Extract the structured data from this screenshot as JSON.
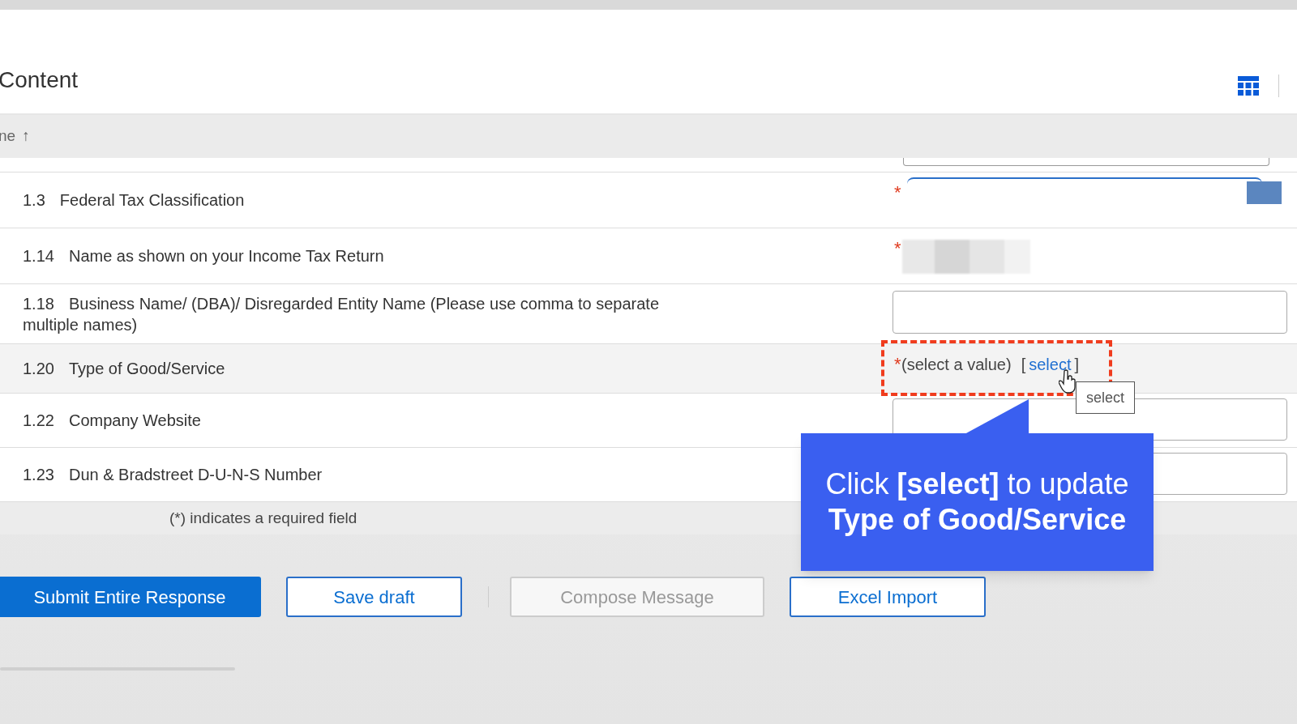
{
  "header": {
    "title": "Content"
  },
  "table": {
    "sort_column": "ne",
    "sort_arrow": "↑",
    "rows": [
      {
        "number": "1.3",
        "label": "Federal Tax Classification",
        "required_mark": "*",
        "highlighted": false,
        "kind": "dropdown"
      },
      {
        "number": "1.14",
        "label": "Name as shown on your Income Tax Return",
        "required_mark": "*",
        "highlighted": false,
        "kind": "redacted"
      },
      {
        "number": "1.18",
        "label": "Business Name/ (DBA)/ Disregarded Entity Name (Please use comma to separate multiple names)",
        "highlighted": false,
        "kind": "textarea"
      },
      {
        "number": "1.20",
        "label": "Type of Good/Service",
        "required_mark": "*",
        "highlighted": true,
        "kind": "select_value",
        "placeholder": "(select a value)",
        "bracket_left": "[",
        "link": "select",
        "bracket_right": "]"
      },
      {
        "number": "1.22",
        "label": "Company Website",
        "highlighted": false,
        "kind": "text"
      },
      {
        "number": "1.23",
        "label": "Dun & Bradstreet D-U-N-S Number",
        "highlighted": false,
        "kind": "text"
      }
    ],
    "footnote": "(*) indicates a required field"
  },
  "buttons": [
    {
      "label": "Submit Entire Response",
      "kind": "primary",
      "disabled": false
    },
    {
      "label": "Save draft",
      "kind": "outline",
      "disabled": false
    },
    {
      "label": "Compose Message",
      "kind": "outline",
      "disabled": true
    },
    {
      "label": "Excel Import",
      "kind": "outline",
      "disabled": false
    }
  ],
  "tooltip": "select",
  "callout": "Click **[select]** to update **Type of Good/Service**"
}
